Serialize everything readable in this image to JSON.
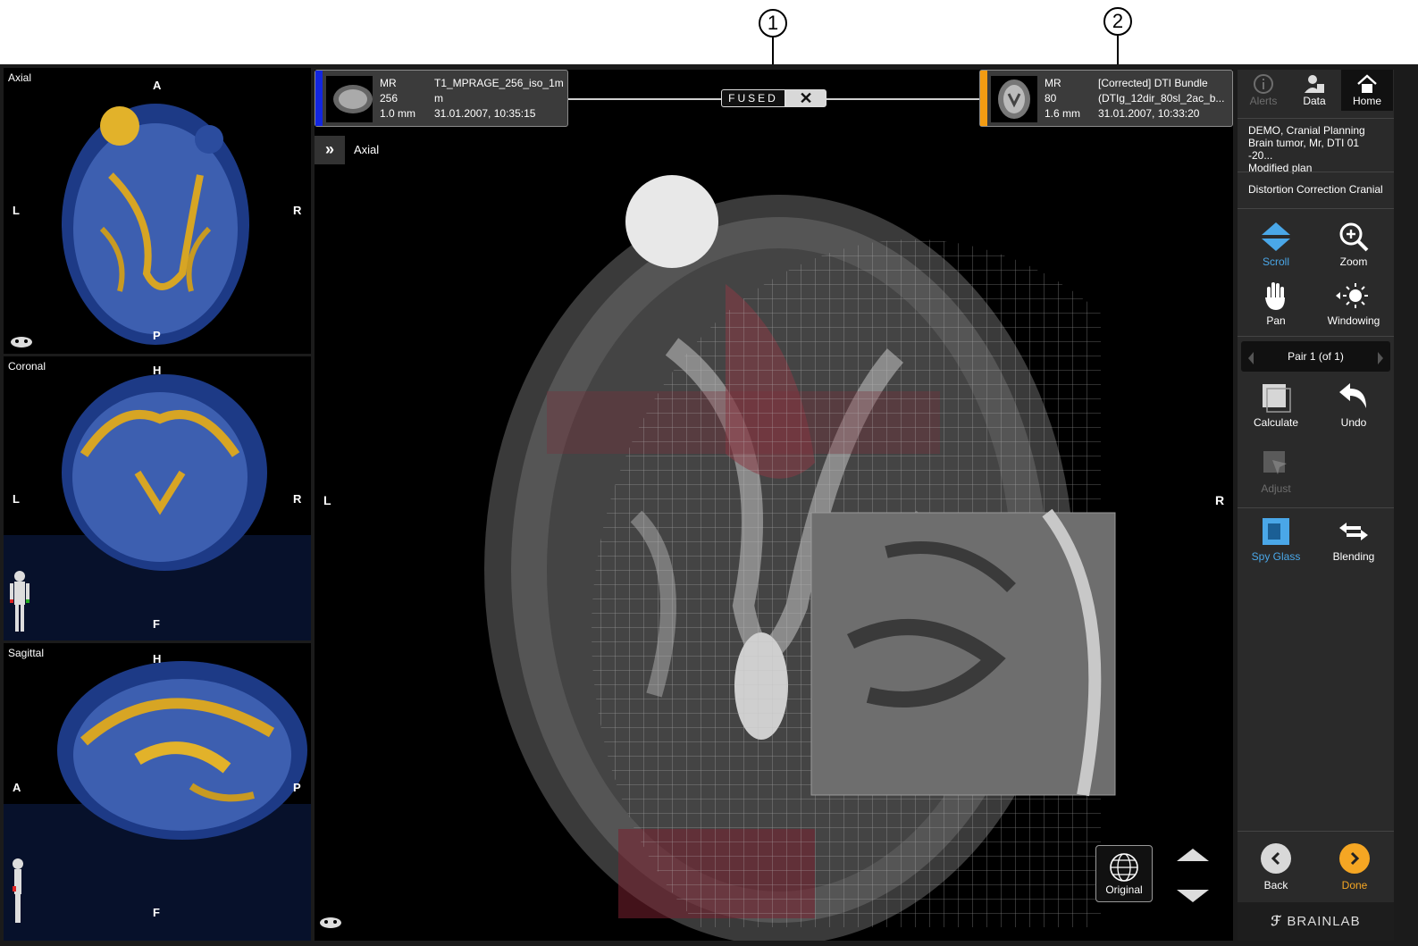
{
  "callouts": [
    "1",
    "2"
  ],
  "left_views": [
    {
      "label": "Axial",
      "top": "A",
      "bottom": "P",
      "left": "L",
      "right": "R"
    },
    {
      "label": "Coronal",
      "top": "H",
      "bottom": "F",
      "left": "L",
      "right": "R"
    },
    {
      "label": "Sagittal",
      "top": "H",
      "bottom": "F",
      "left": "A",
      "right": "P"
    }
  ],
  "series_left": {
    "modality": "MR",
    "slices": "256",
    "thickness": "1.0 mm",
    "name_line1": "T1_MPRAGE_256_iso_1m",
    "name_line2": "m",
    "date": "31.01.2007, 10:35:15",
    "color": "#1226e0"
  },
  "series_right": {
    "modality": "MR",
    "slices": "80",
    "thickness": "1.6 mm",
    "name_line1": "[Corrected] DTI Bundle",
    "name_line2": "(DTIg_12dir_80sl_2ac_b...",
    "date": "31.01.2007, 10:33:20",
    "color": "#f39c12"
  },
  "fused_label": "FUSED",
  "fused_close": "✕",
  "main_view": {
    "label": "Axial",
    "left": "L",
    "right": "R",
    "expand": "»"
  },
  "original_button": "Original",
  "top_buttons": {
    "alerts": "Alerts",
    "data": "Data",
    "home": "Home"
  },
  "info": {
    "line1": "DEMO, Cranial Planning",
    "line2": "Brain tumor, Mr, DTI 01 -20...",
    "line3": "Modified plan"
  },
  "workflow": "Distortion Correction Cranial",
  "tools": {
    "scroll": "Scroll",
    "zoom": "Zoom",
    "pan": "Pan",
    "windowing": "Windowing",
    "calculate": "Calculate",
    "undo": "Undo",
    "adjust": "Adjust",
    "spy_glass": "Spy Glass",
    "blending": "Blending"
  },
  "pair": "Pair 1 (of 1)",
  "nav": {
    "back": "Back",
    "done": "Done"
  },
  "brand": "BRAINLAB",
  "colors": {
    "accent_blue": "#4aa7e8",
    "done_orange": "#f5a623"
  }
}
